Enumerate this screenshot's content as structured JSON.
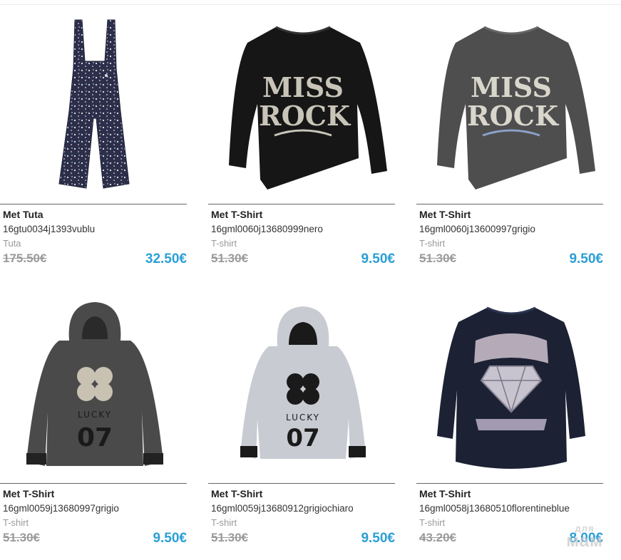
{
  "products": [
    {
      "name": "Met Tuta",
      "code": "16gtu0034j1393vublu",
      "category": "Tuta",
      "old_price": "175.50€",
      "new_price": "32.50€",
      "icon": "jumpsuit-image",
      "color": "#2b2f4a"
    },
    {
      "name": "Met T-Shirt",
      "code": "16gml0060j13680999nero",
      "category": "T-shirt",
      "old_price": "51.30€",
      "new_price": "9.50€",
      "icon": "shirt-miss-rock-image",
      "color": "#161616"
    },
    {
      "name": "Met T-Shirt",
      "code": "16gml0060j13600997grigio",
      "category": "T-shirt",
      "old_price": "51.30€",
      "new_price": "9.50€",
      "icon": "shirt-miss-rock-image",
      "color": "#4e4e4e"
    },
    {
      "name": "Met T-Shirt",
      "code": "16gml0059j13680997grigio",
      "category": "T-shirt",
      "old_price": "51.30€",
      "new_price": "9.50€",
      "icon": "hoodie-lucky-image",
      "color": "#4a4a4a"
    },
    {
      "name": "Met T-Shirt",
      "code": "16gml0059j13680912grigiochiaro",
      "category": "T-shirt",
      "old_price": "51.30€",
      "new_price": "9.50€",
      "icon": "hoodie-lucky-image",
      "color": "#c9cbd3"
    },
    {
      "name": "Met T-Shirt",
      "code": "16gml0058j13680510florentineblue",
      "category": "T-shirt",
      "old_price": "43.20€",
      "new_price": "8.00€",
      "icon": "shirt-diamond-image",
      "color": "#1c2234"
    }
  ],
  "watermark": {
    "top": "для",
    "bottom": "мам"
  }
}
